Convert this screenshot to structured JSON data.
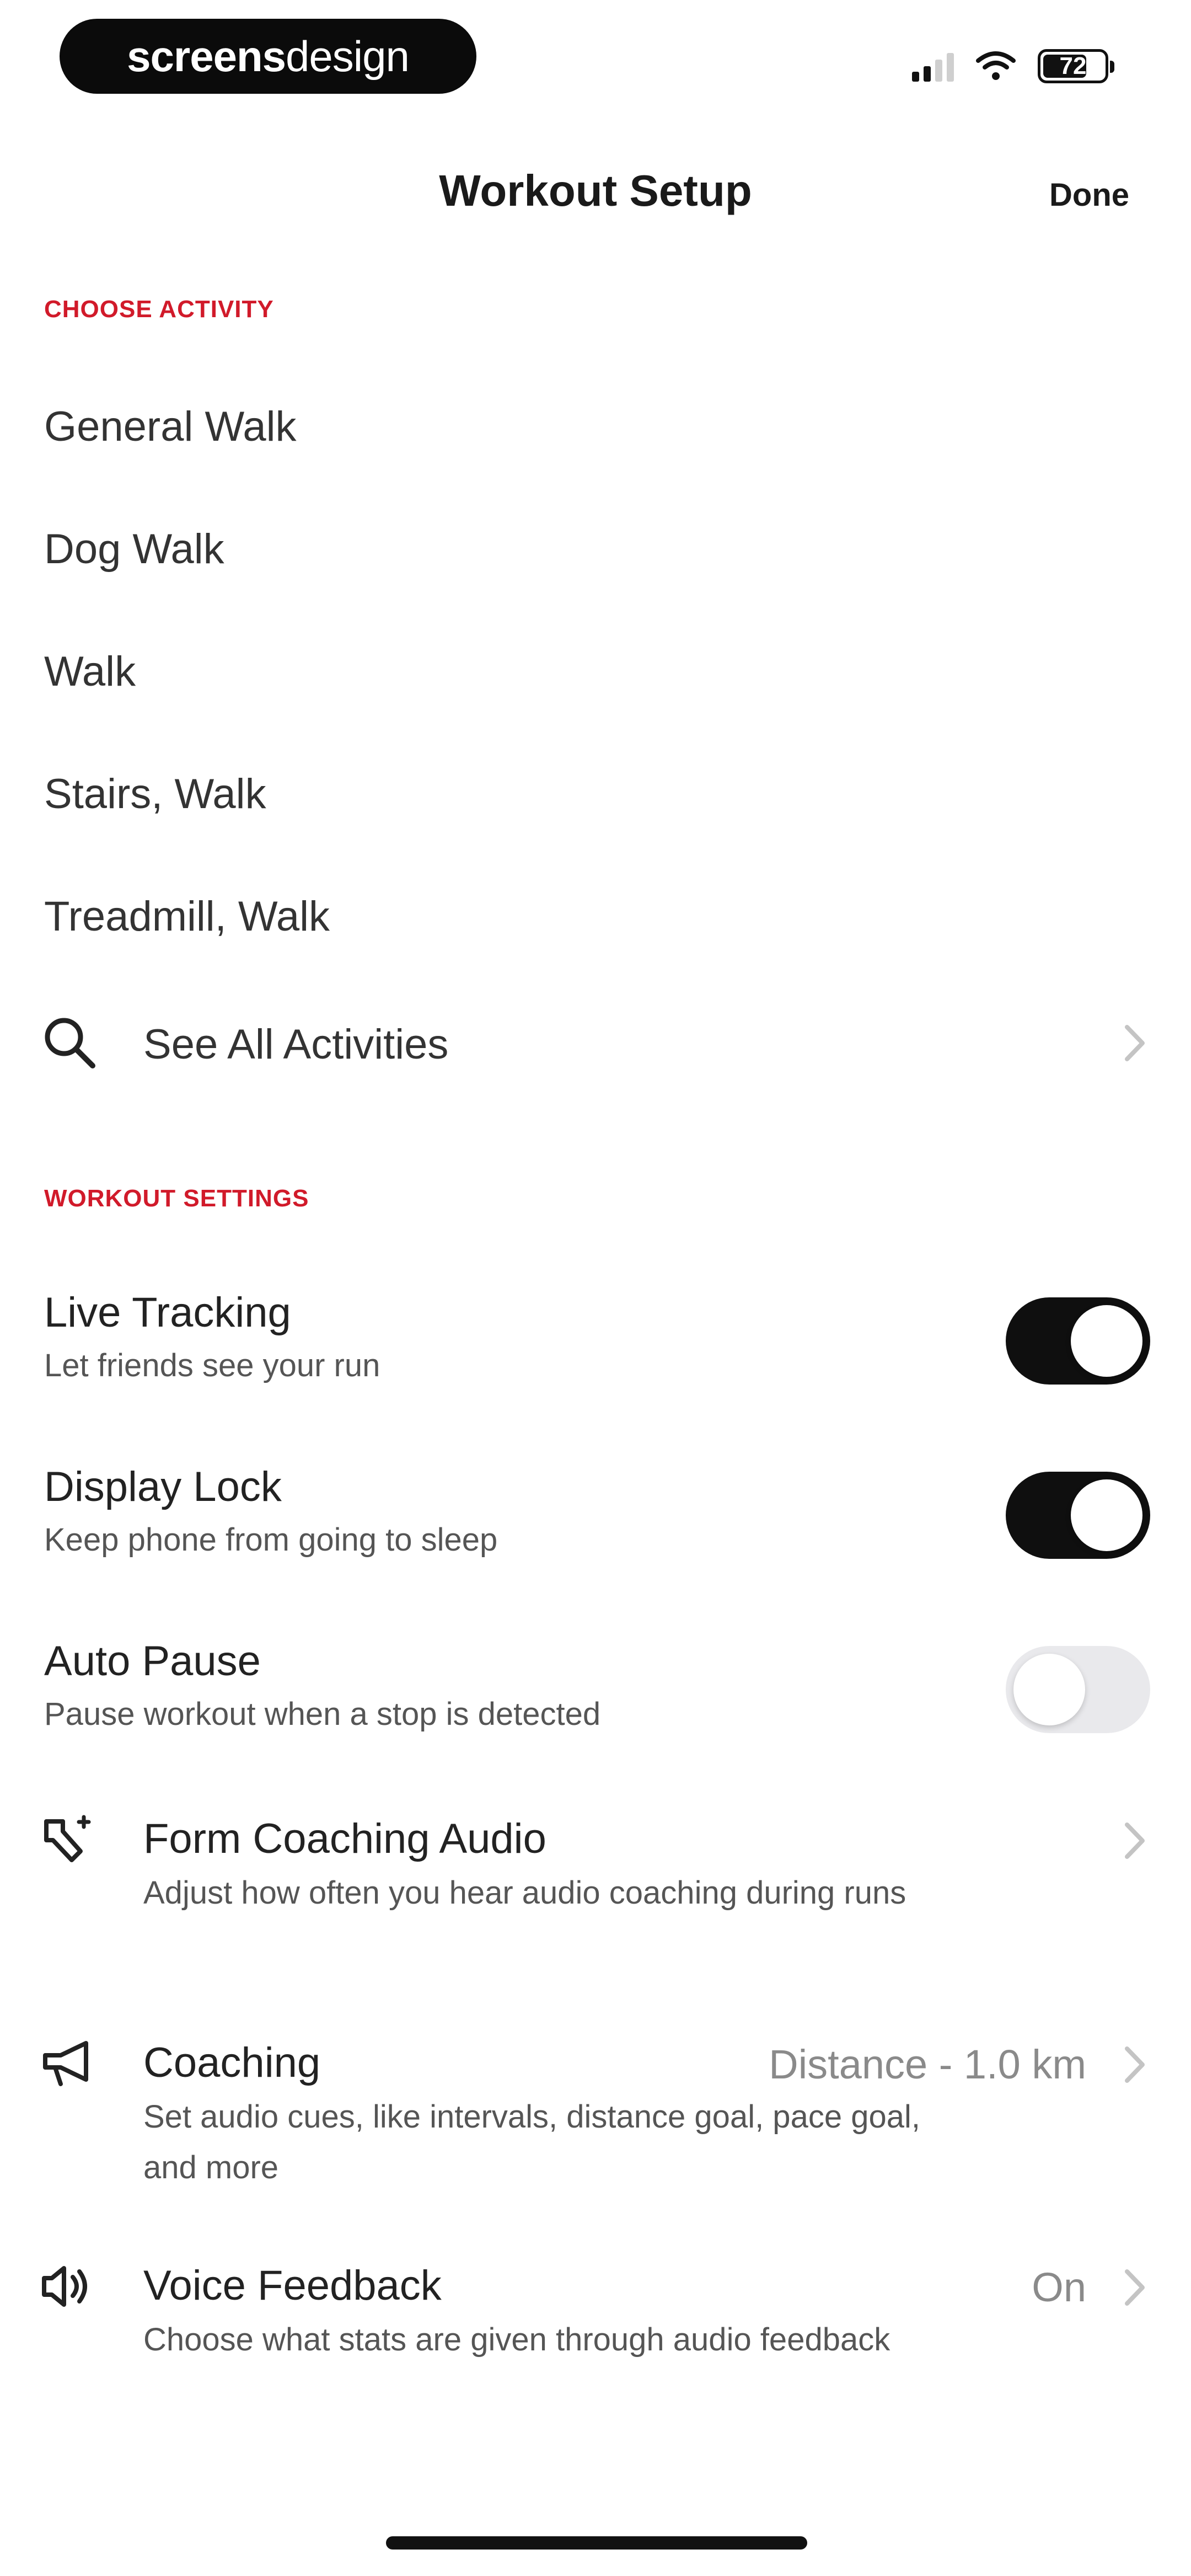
{
  "status_bar": {
    "brand_part1": "screens",
    "brand_part2": "design",
    "battery": "72",
    "battery_level": 0.72
  },
  "nav": {
    "title": "Workout Setup",
    "done_label": "Done"
  },
  "choose_activity": {
    "header": "CHOOSE ACTIVITY",
    "items": [
      "General Walk",
      "Dog Walk",
      "Walk",
      "Stairs, Walk",
      "Treadmill, Walk"
    ],
    "see_all_label": "See All Activities"
  },
  "workout_settings": {
    "header": "WORKOUT SETTINGS",
    "toggles": [
      {
        "title": "Live Tracking",
        "subtitle": "Let friends see your run",
        "on": true
      },
      {
        "title": "Display Lock",
        "subtitle": "Keep phone from going to sleep",
        "on": true
      },
      {
        "title": "Auto Pause",
        "subtitle": "Pause workout when a stop is detected",
        "on": false
      }
    ],
    "links": [
      {
        "title": "Form Coaching Audio",
        "subtitle": "Adjust how often you hear audio coaching during runs",
        "value": "",
        "icon": "form-coaching-icon"
      },
      {
        "title": "Coaching",
        "subtitle": "Set audio cues, like intervals, distance goal, pace goal, and more",
        "value": "Distance - 1.0 km",
        "icon": "megaphone-icon"
      },
      {
        "title": "Voice Feedback",
        "subtitle": "Choose what stats are given through audio feedback",
        "value": "On",
        "icon": "speaker-icon"
      }
    ]
  },
  "colors": {
    "accent": "#d11a2a",
    "toggle_on": "#0f0f0f",
    "toggle_off": "#e9e9ec"
  }
}
